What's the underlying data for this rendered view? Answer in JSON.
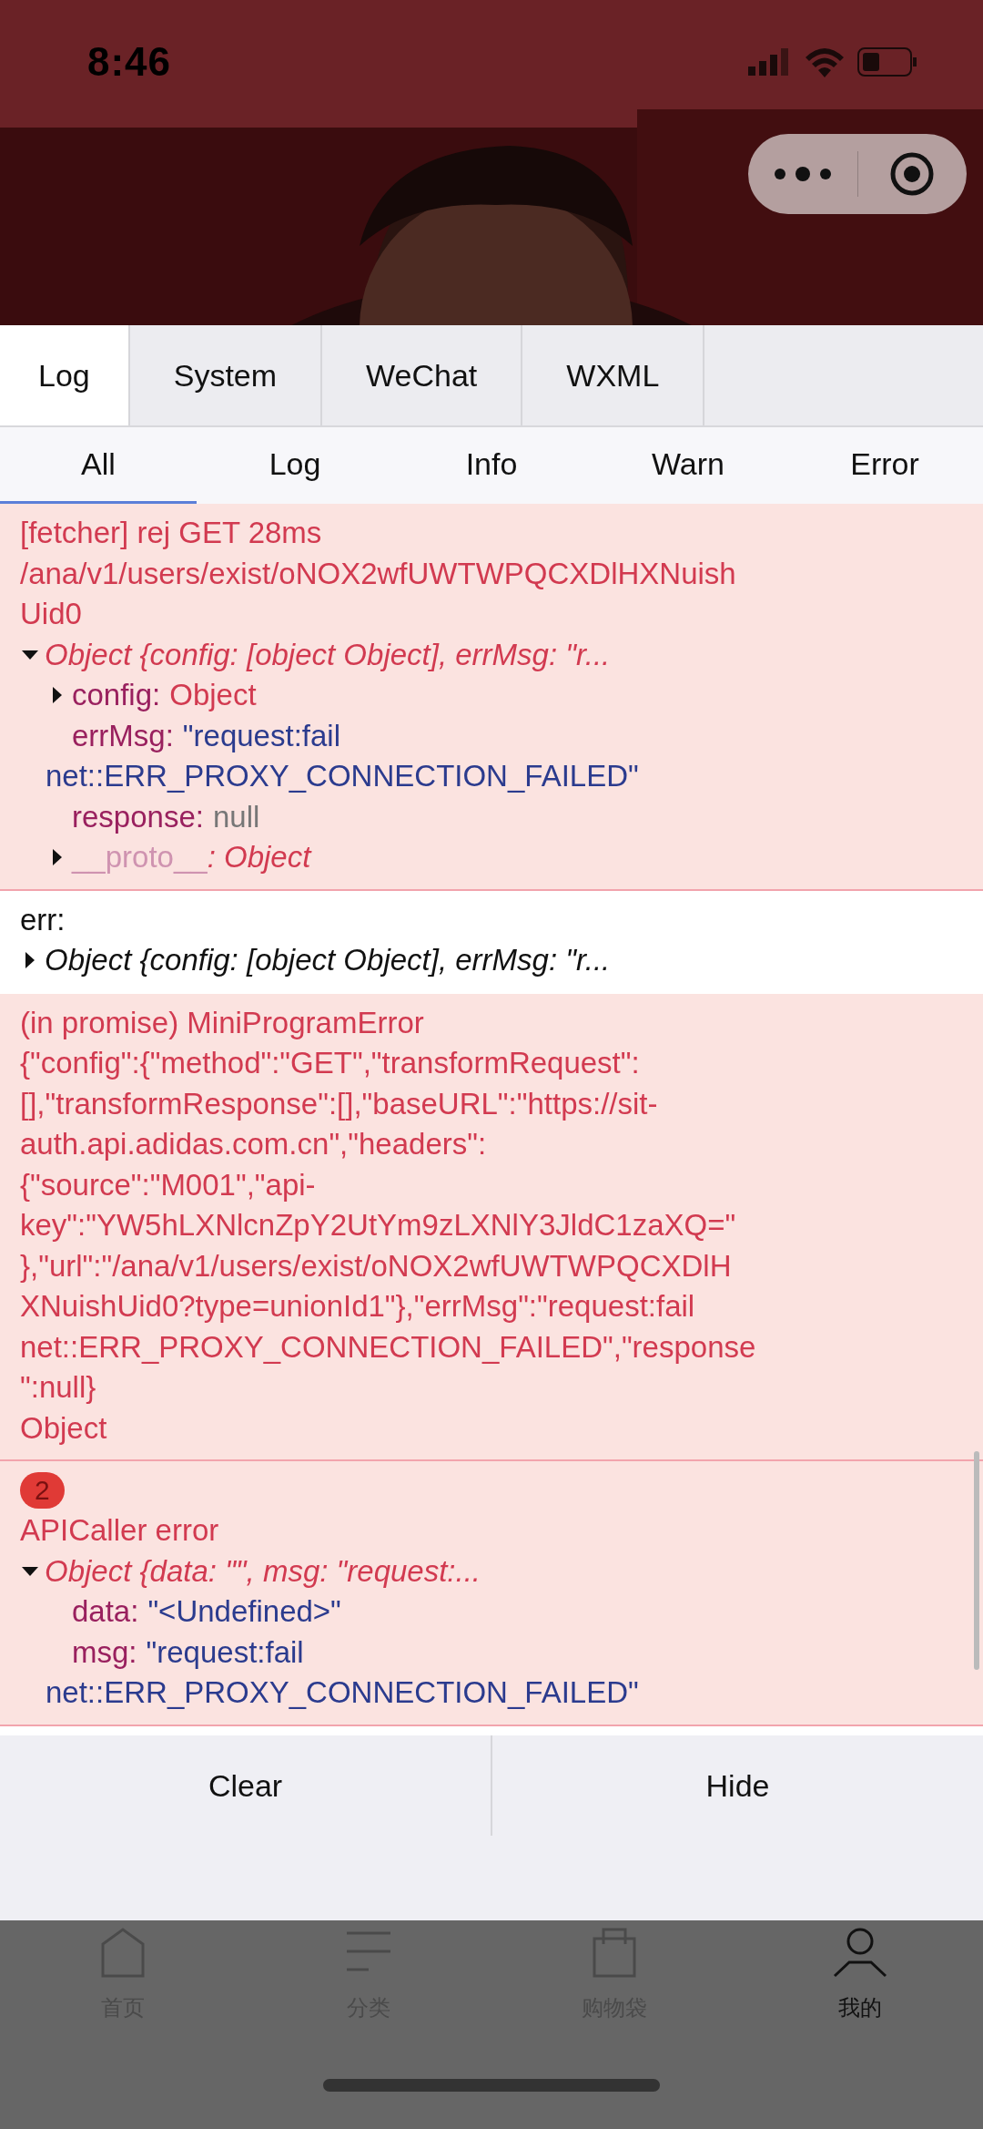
{
  "status_bar": {
    "time": "8:46"
  },
  "tabs": [
    {
      "label": "Log",
      "selected": true
    },
    {
      "label": "System",
      "selected": false
    },
    {
      "label": "WeChat",
      "selected": false
    },
    {
      "label": "WXML",
      "selected": false
    }
  ],
  "filters": [
    {
      "label": "All",
      "selected": true
    },
    {
      "label": "Log",
      "selected": false
    },
    {
      "label": "Info",
      "selected": false
    },
    {
      "label": "Warn",
      "selected": false
    },
    {
      "label": "Error",
      "selected": false
    }
  ],
  "entries": [
    {
      "kind": "error",
      "lines": [
        "[fetcher] rej GET 28ms",
        "/ana/v1/users/exist/oNOX2wfUWTWPQCXDlHXNuish",
        "Uid0"
      ],
      "object": {
        "summary": "Object {config: [object Object], errMsg: \"r...",
        "expanded": true,
        "props": [
          {
            "key": "config:",
            "value": "Object",
            "kind": "object",
            "expanded": false
          },
          {
            "key": "errMsg:",
            "value": "\"request:fail",
            "more": "net::ERR_PROXY_CONNECTION_FAILED\"",
            "kind": "string"
          },
          {
            "key": "response:",
            "value": "null",
            "kind": "null"
          },
          {
            "key": "__proto__",
            "value": ": Object",
            "kind": "proto",
            "expanded": false
          }
        ]
      }
    },
    {
      "kind": "log",
      "lines": [
        "err:"
      ],
      "object": {
        "summary": "Object {config: [object Object], errMsg: \"r...",
        "expanded": false
      }
    },
    {
      "kind": "error",
      "lines": [
        "(in promise) MiniProgramError",
        "{\"config\":{\"method\":\"GET\",\"transformRequest\":",
        "[],\"transformResponse\":[],\"baseURL\":\"https://sit-",
        "auth.api.adidas.com.cn\",\"headers\":",
        "{\"source\":\"M001\",\"api-",
        "key\":\"YW5hLXNlcnZpY2UtYm9zLXNlY3JldC1zaXQ=\"",
        "},\"url\":\"/ana/v1/users/exist/oNOX2wfUWTWPQCXDlH",
        "XNuishUid0?type=unionId1\"},\"errMsg\":\"request:fail",
        "net::ERR_PROXY_CONNECTION_FAILED\",\"response",
        "\":null}",
        "Object"
      ]
    },
    {
      "kind": "error",
      "count": "2",
      "lines": [
        "APICaller error"
      ],
      "object": {
        "summary": "Object {data: \"\", msg: \"request:...",
        "expanded": true,
        "props": [
          {
            "key": "data:",
            "value": "\"<Undefined>\"",
            "kind": "string"
          },
          {
            "key": "msg:",
            "value": "\"request:fail",
            "more": "net::ERR_PROXY_CONNECTION_FAILED\"",
            "kind": "string"
          }
        ]
      }
    }
  ],
  "actions": [
    "Clear",
    "Hide"
  ],
  "nav": [
    {
      "kind": "home",
      "label": "首页",
      "selected": false
    },
    {
      "kind": "list",
      "label": "分类",
      "selected": false
    },
    {
      "kind": "bag",
      "label": "购物袋",
      "selected": false
    },
    {
      "kind": "person",
      "label": "我的",
      "selected": true
    }
  ]
}
